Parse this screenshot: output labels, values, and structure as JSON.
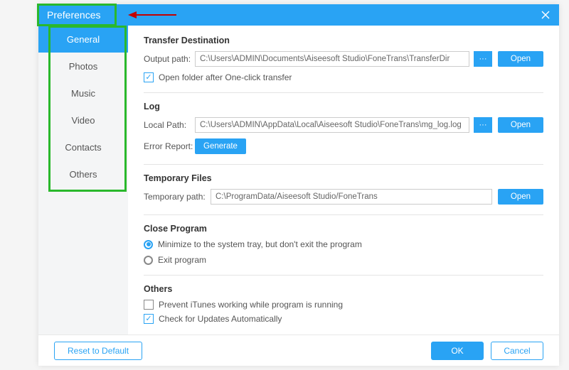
{
  "window": {
    "title": "Preferences"
  },
  "sidebar": {
    "items": [
      {
        "label": "General",
        "active": true
      },
      {
        "label": "Photos",
        "active": false
      },
      {
        "label": "Music",
        "active": false
      },
      {
        "label": "Video",
        "active": false
      },
      {
        "label": "Contacts",
        "active": false
      },
      {
        "label": "Others",
        "active": false
      }
    ]
  },
  "sections": {
    "transfer": {
      "title": "Transfer Destination",
      "output_label": "Output path:",
      "output_value": "C:\\Users\\ADMIN\\Documents\\Aiseesoft Studio\\FoneTrans\\TransferDir",
      "browse_label": "···",
      "open_label": "Open",
      "open_after_label": "Open folder after One-click transfer",
      "open_after_checked": true
    },
    "log": {
      "title": "Log",
      "local_label": "Local Path:",
      "local_value": "C:\\Users\\ADMIN\\AppData\\Local\\Aiseesoft Studio\\FoneTrans\\mg_log.log",
      "browse_label": "···",
      "open_label": "Open",
      "error_label": "Error Report:",
      "generate_label": "Generate"
    },
    "temp": {
      "title": "Temporary Files",
      "path_label": "Temporary path:",
      "path_value": "C:\\ProgramData/Aiseesoft Studio/FoneTrans",
      "open_label": "Open"
    },
    "close": {
      "title": "Close Program",
      "minimize_label": "Minimize to the system tray, but don't exit the program",
      "exit_label": "Exit program",
      "selected": "minimize"
    },
    "others": {
      "title": "Others",
      "prevent_label": "Prevent iTunes working while program is running",
      "prevent_checked": false,
      "updates_label": "Check for Updates Automatically",
      "updates_checked": true
    }
  },
  "footer": {
    "reset_label": "Reset to Default",
    "ok_label": "OK",
    "cancel_label": "Cancel"
  },
  "colors": {
    "accent": "#29a3f4",
    "highlight": "#2ab82c"
  }
}
